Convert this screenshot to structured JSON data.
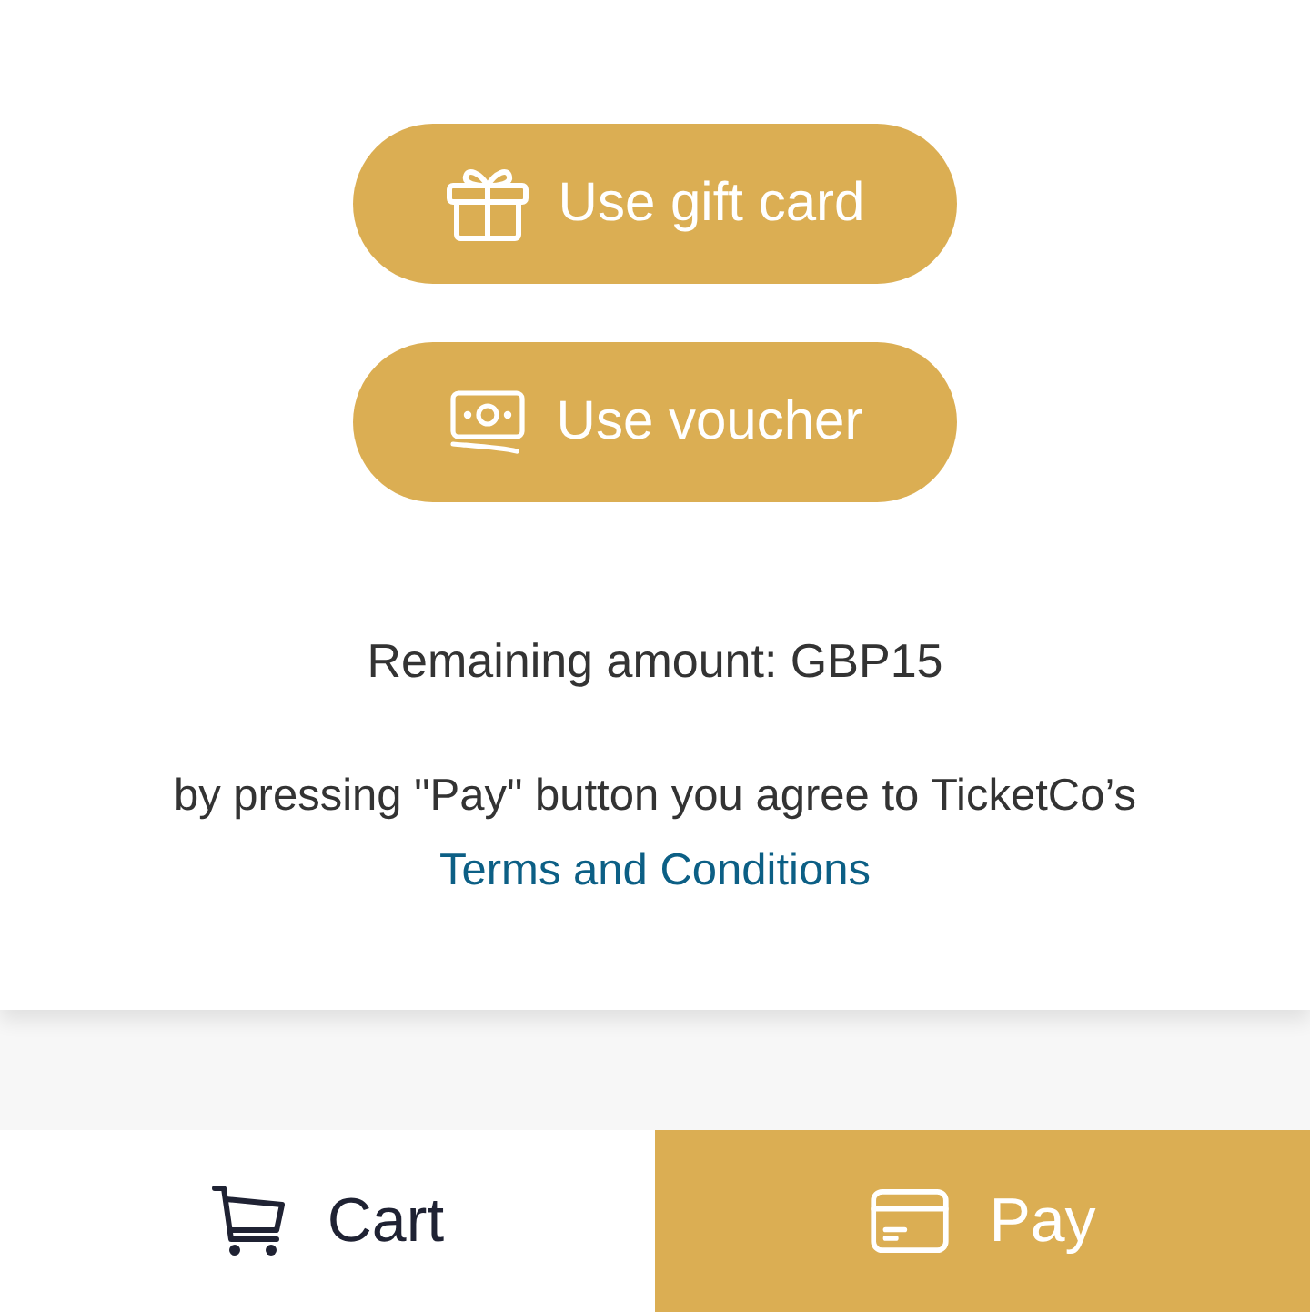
{
  "actions": [
    {
      "kind": "gift_card",
      "label": "Use gift card"
    },
    {
      "kind": "voucher",
      "label": "Use voucher"
    }
  ],
  "remaining": "Remaining amount: GBP15",
  "agreement": {
    "text": "by pressing \"Pay\" button you agree to TicketCo’s",
    "link": "Terms and Conditions"
  },
  "bottom_bar": [
    {
      "kind": "cart",
      "label": "Cart"
    },
    {
      "kind": "pay",
      "label": "Pay"
    }
  ]
}
